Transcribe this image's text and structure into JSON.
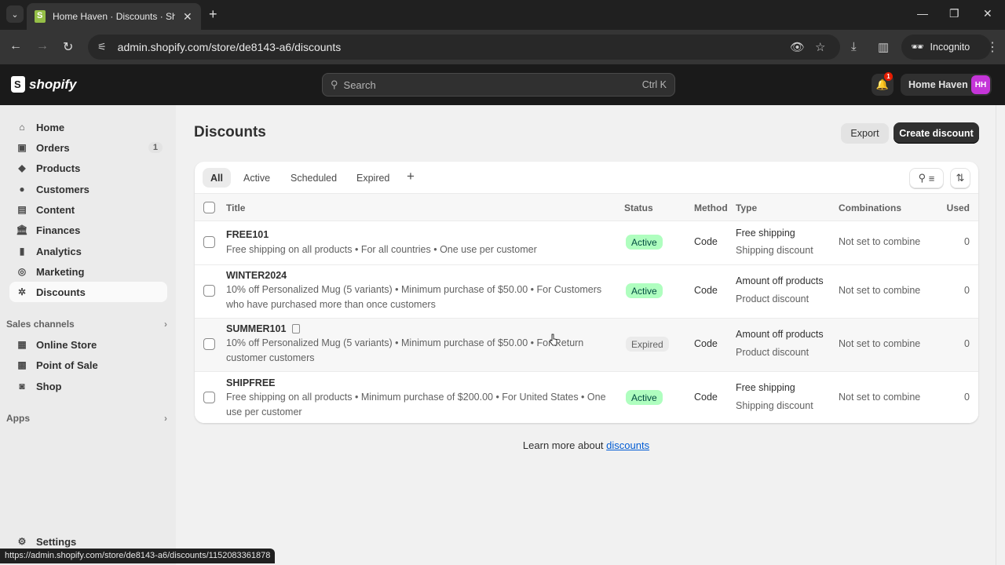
{
  "browser": {
    "tab_title": "Home Haven · Discounts · Shop",
    "url": "admin.shopify.com/store/de8143-a6/discounts",
    "incognito_label": "Incognito",
    "status_url": "https://admin.shopify.com/store/de8143-a6/discounts/1152083361878"
  },
  "topbar": {
    "logo_text": "shopify",
    "search_placeholder": "Search",
    "search_shortcut": "Ctrl K",
    "notification_count": "1",
    "store_name": "Home Haven",
    "avatar_initials": "HH"
  },
  "sidebar": {
    "items": [
      {
        "label": "Home",
        "icon": "home-icon"
      },
      {
        "label": "Orders",
        "icon": "inbox-icon",
        "count": "1"
      },
      {
        "label": "Products",
        "icon": "tag-icon"
      },
      {
        "label": "Customers",
        "icon": "person-icon"
      },
      {
        "label": "Content",
        "icon": "content-icon"
      },
      {
        "label": "Finances",
        "icon": "bank-icon"
      },
      {
        "label": "Analytics",
        "icon": "bar-chart-icon"
      },
      {
        "label": "Marketing",
        "icon": "target-icon"
      },
      {
        "label": "Discounts",
        "icon": "discount-icon",
        "selected": true
      }
    ],
    "sales_channels_label": "Sales channels",
    "channels": [
      {
        "label": "Online Store",
        "icon": "store-icon"
      },
      {
        "label": "Point of Sale",
        "icon": "pos-icon"
      },
      {
        "label": "Shop",
        "icon": "shop-icon"
      }
    ],
    "apps_label": "Apps",
    "settings_label": "Settings"
  },
  "main": {
    "title": "Discounts",
    "export_label": "Export",
    "create_label": "Create discount",
    "filter_tabs": [
      "All",
      "Active",
      "Scheduled",
      "Expired"
    ],
    "selected_tab": "All",
    "columns": [
      "Title",
      "Status",
      "Method",
      "Type",
      "Combinations",
      "Used"
    ],
    "rows": [
      {
        "title": "FREE101",
        "description": "Free shipping on all products • For all countries • One use per customer",
        "status": "Active",
        "method": "Code",
        "type": "Free shipping",
        "type_sub": "Shipping discount",
        "combinations": "Not set to combine",
        "used": "0"
      },
      {
        "title": "WINTER2024",
        "description": "10% off Personalized Mug (5 variants) • Minimum purchase of $50.00 • For Customers who have purchased more than once customers",
        "status": "Active",
        "method": "Code",
        "type": "Amount off products",
        "type_sub": "Product discount",
        "combinations": "Not set to combine",
        "used": "0"
      },
      {
        "title": "SUMMER101",
        "description": "10% off Personalized Mug (5 variants) • Minimum purchase of $50.00 • For Return customer customers",
        "status": "Expired",
        "method": "Code",
        "type": "Amount off products",
        "type_sub": "Product discount",
        "combinations": "Not set to combine",
        "used": "0"
      },
      {
        "title": "SHIPFREE",
        "description": "Free shipping on all products • Minimum purchase of $200.00 • For United States • One use per customer",
        "status": "Active",
        "method": "Code",
        "type": "Free shipping",
        "type_sub": "Shipping discount",
        "combinations": "Not set to combine",
        "used": "0"
      }
    ],
    "learn_more_text": "Learn more about ",
    "learn_more_link": "discounts"
  },
  "colors": {
    "active_badge_bg": "#affebf",
    "active_badge_text": "#014b40",
    "expired_badge_bg": "#ebebeb",
    "avatar_bg": "#c435d8",
    "link": "#005bd3",
    "primary_button": "#303030"
  }
}
